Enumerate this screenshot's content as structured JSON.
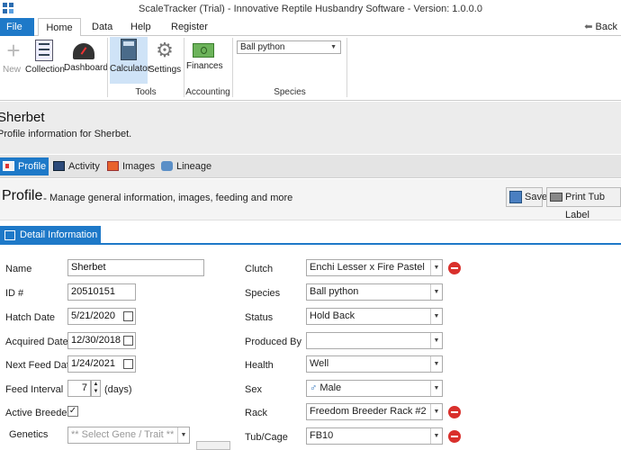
{
  "window": {
    "title": "ScaleTracker (Trial) - Innovative Reptile Husbandry Software - Version: 1.0.0.0"
  },
  "menu": {
    "file": "File",
    "home": "Home",
    "data": "Data",
    "help": "Help",
    "register": "Register",
    "back": "Back"
  },
  "ribbon": {
    "new": "New",
    "collection": "Collection",
    "dashboard": "Dashboard",
    "calculator": "Calculator",
    "settings": "Settings",
    "finances": "Finances",
    "tools_label": "Tools",
    "accounting_label": "Accounting",
    "species_label": "Species",
    "species_value": "Ball python"
  },
  "animal": {
    "name": "Sherbet",
    "subtitle": "Profile information for Sherbet."
  },
  "subtabs": {
    "profile": "Profile",
    "activity": "Activity",
    "images": "Images",
    "lineage": "Lineage"
  },
  "profile": {
    "title": "Profile",
    "dash": "-",
    "description": "Manage general information, images, feeding and more",
    "save": "Save",
    "print": "Print Tub Label"
  },
  "detail": {
    "tab": "Detail Information"
  },
  "form": {
    "name_label": "Name",
    "name_value": "Sherbet",
    "id_label": "ID #",
    "id_value": "20510151",
    "hatch_label": "Hatch Date",
    "hatch_value": "5/21/2020",
    "acquired_label": "Acquired Date",
    "acquired_value": "12/30/2018",
    "nextfeed_label": "Next Feed Date",
    "nextfeed_value": "1/24/2021",
    "interval_label": "Feed Interval",
    "interval_value": "7",
    "interval_unit": "(days)",
    "breeder_label": "Active Breeder",
    "breeder_check": "✓",
    "genetics_label": "Genetics",
    "genetics_placeholder": "** Select Gene / Trait **",
    "clutch_label": "Clutch",
    "clutch_value": "Enchi Lesser x Fire Pastel",
    "species_label": "Species",
    "species_value": "Ball python",
    "status_label": "Status",
    "status_value": "Hold Back",
    "produced_label": "Produced By",
    "produced_value": "",
    "health_label": "Health",
    "health_value": "Well",
    "sex_label": "Sex",
    "sex_value": "Male",
    "sex_symbol": "♂",
    "rack_label": "Rack",
    "rack_value": "Freedom Breeder Rack #2",
    "tub_label": "Tub/Cage",
    "tub_value": "FB10"
  },
  "colors": {
    "accent": "#1e79c8",
    "remove": "#d9302c"
  }
}
